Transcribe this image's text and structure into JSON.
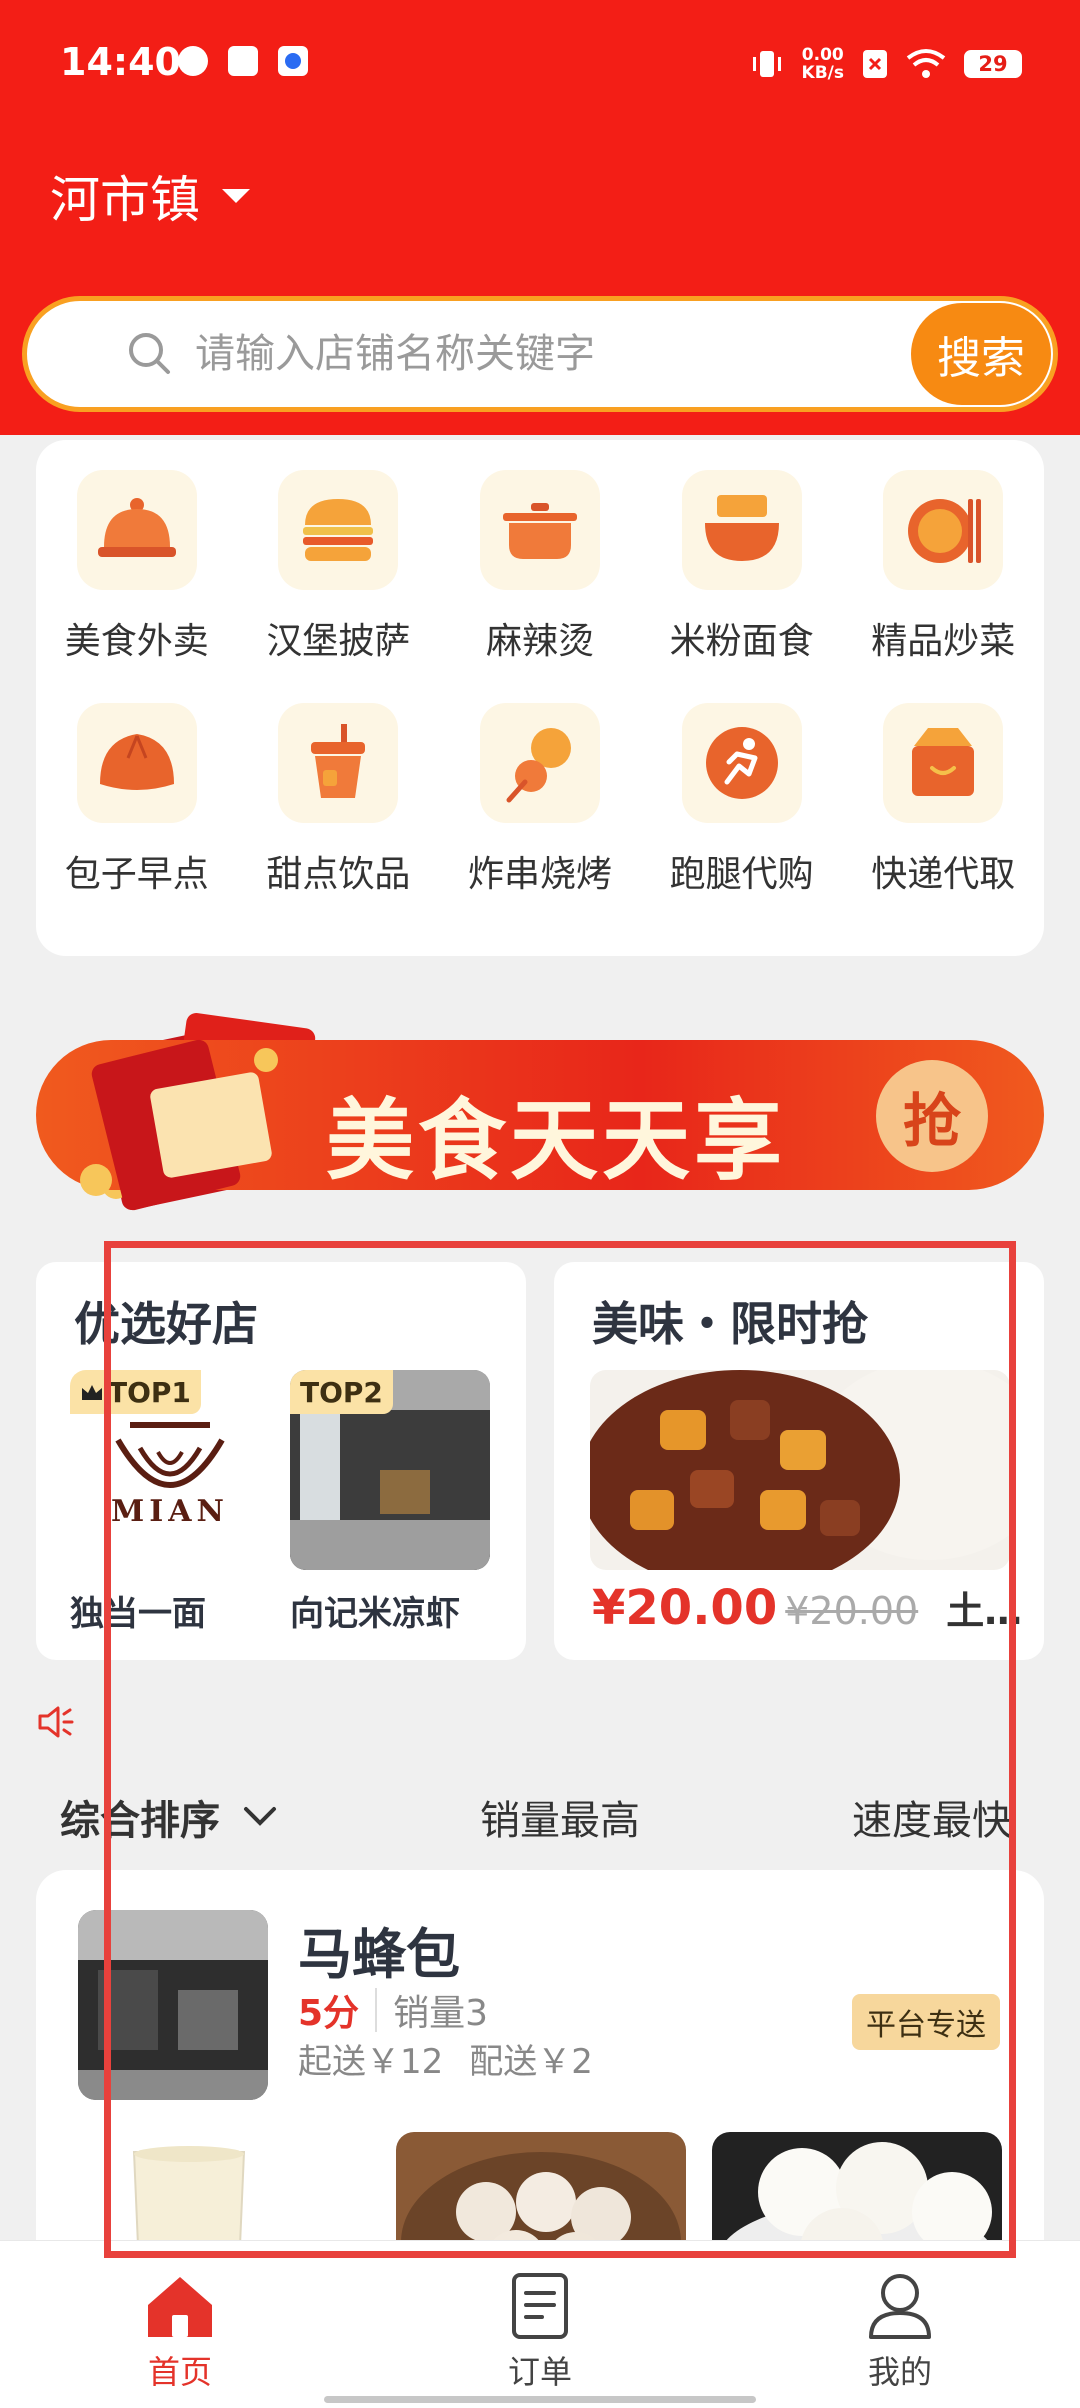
{
  "status": {
    "time": "14:40",
    "net_speed": "0.00",
    "net_unit": "KB/s",
    "battery": "29"
  },
  "location": {
    "name": "河市镇"
  },
  "search": {
    "placeholder": "请输入店铺名称关键字",
    "button": "搜索"
  },
  "categories": [
    {
      "label": "美食外卖",
      "icon": "food-cloche-icon"
    },
    {
      "label": "汉堡披萨",
      "icon": "burger-icon"
    },
    {
      "label": "麻辣烫",
      "icon": "hotpot-icon"
    },
    {
      "label": "米粉面食",
      "icon": "noodle-bowl-icon"
    },
    {
      "label": "精品炒菜",
      "icon": "plate-chopsticks-icon"
    },
    {
      "label": "包子早点",
      "icon": "bun-icon"
    },
    {
      "label": "甜点饮品",
      "icon": "drink-cup-icon"
    },
    {
      "label": "炸串烧烤",
      "icon": "skewer-icon"
    },
    {
      "label": "跑腿代购",
      "icon": "runner-icon"
    },
    {
      "label": "快递代取",
      "icon": "parcel-icon"
    }
  ],
  "banner": {
    "text": "美食天天享",
    "button": "抢"
  },
  "featured": {
    "title": "优选好店",
    "shops": [
      {
        "tag": "TOP1",
        "name": "独当一面",
        "logo_text": "MIAN"
      },
      {
        "tag": "TOP2",
        "name": "向记米凉虾"
      }
    ]
  },
  "flash": {
    "title": "美味・限时抢",
    "price": "¥20.00",
    "original_price": "¥20.00",
    "item": "土…"
  },
  "sort": {
    "comprehensive": "综合排序",
    "sales": "销量最高",
    "speed": "速度最快"
  },
  "store": {
    "name": "马蜂包",
    "score": "5分",
    "sales": "销量3",
    "min_order": "起送￥12",
    "delivery_fee": "配送￥2",
    "badge": "平台专送"
  },
  "nav": {
    "home": "首页",
    "orders": "订单",
    "mine": "我的"
  },
  "colors": {
    "primary_red": "#f31e16",
    "accent_orange": "#f78a12",
    "highlight": "#e8413c"
  }
}
